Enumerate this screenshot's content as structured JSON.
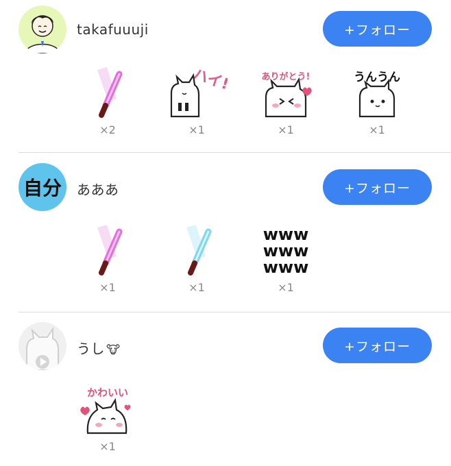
{
  "follow_label": "+フォロー",
  "users": [
    {
      "username": "takafuuuji",
      "gifts": [
        {
          "type": "pink-glowstick",
          "count": "×2"
        },
        {
          "type": "cat-hai-sticker",
          "count": "×1"
        },
        {
          "type": "cat-arigatou-sticker",
          "count": "×1"
        },
        {
          "type": "cat-un-un-sticker",
          "count": "×1"
        }
      ]
    },
    {
      "username": "あああ",
      "avatar_text": "自分",
      "gifts": [
        {
          "type": "pink-glowstick",
          "count": "×1"
        },
        {
          "type": "blue-glowstick",
          "count": "×1"
        },
        {
          "type": "www-sticker",
          "count": "×1"
        }
      ]
    },
    {
      "username": "うし",
      "username_icon": "🐮",
      "gifts": [
        {
          "type": "cat-kawaii-sticker",
          "count": "×1"
        }
      ]
    }
  ],
  "sticker_text": {
    "hai": "ハイ!",
    "arigatou": "ありがとう!",
    "unun": "うんうん",
    "www": [
      "www",
      "www",
      "www"
    ],
    "kawaii": "かわいい"
  }
}
